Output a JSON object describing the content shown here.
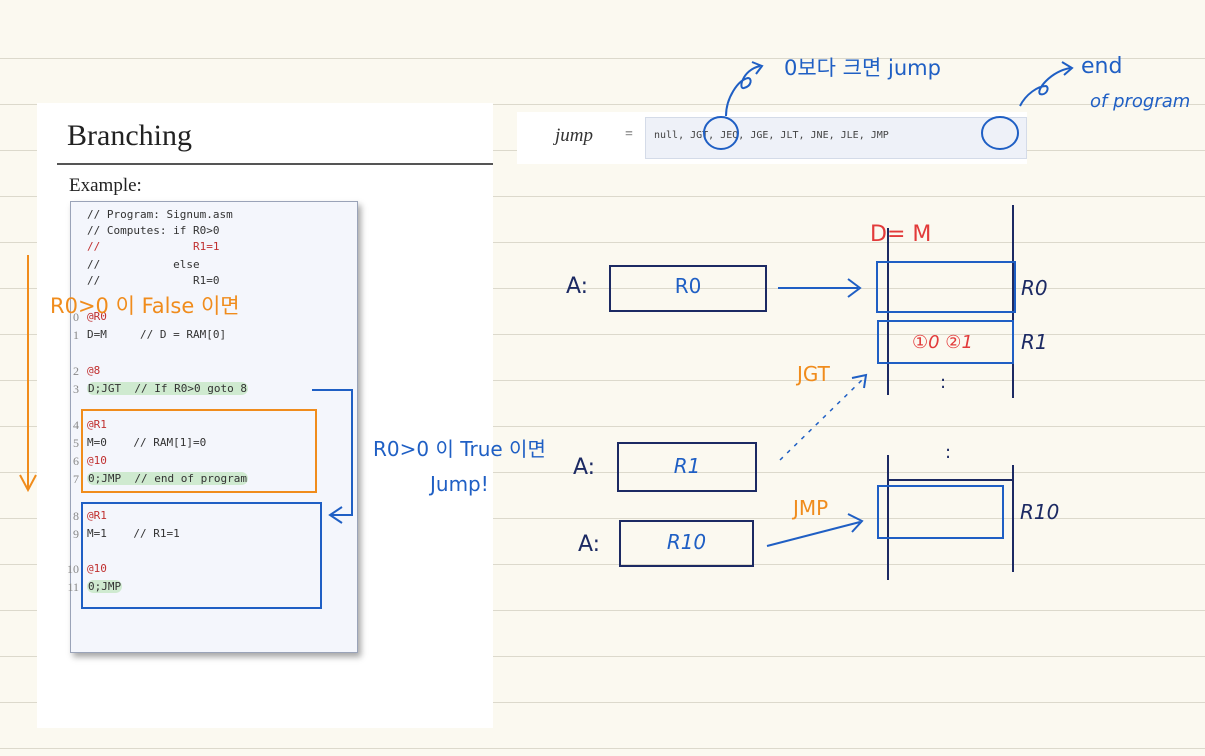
{
  "slide": {
    "title": "Branching",
    "example_label": "Example:",
    "code_lines": [
      {
        "n": "",
        "text": "// Program: Signum.asm"
      },
      {
        "n": "",
        "text": "// Computes: if R0>0"
      },
      {
        "n": "",
        "text": "//              R1=1"
      },
      {
        "n": "",
        "text": "//           else"
      },
      {
        "n": "",
        "text": "//              R1=0"
      },
      {
        "n": "0",
        "text": "@R0"
      },
      {
        "n": "1",
        "text": "D=M     // D = RAM[0]"
      },
      {
        "n": "2",
        "text": "@8"
      },
      {
        "n": "3",
        "text": "D;JGT  // If R0>0 goto 8"
      },
      {
        "n": "4",
        "text": "@R1"
      },
      {
        "n": "5",
        "text": "M=0    // RAM[1]=0"
      },
      {
        "n": "6",
        "text": "@10"
      },
      {
        "n": "7",
        "text": "0;JMP  // end of program"
      },
      {
        "n": "8",
        "text": "@R1"
      },
      {
        "n": "9",
        "text": "M=1    // R1=1"
      },
      {
        "n": "10",
        "text": "@10"
      },
      {
        "n": "11",
        "text": "0;JMP"
      }
    ]
  },
  "jump_syntax": {
    "label": "jump",
    "equals": "=",
    "options_text": "null, JGT, JEQ, JGE, JLT, JNE, JLE, JMP"
  },
  "notes": {
    "jgt_meaning": "0보다 크면 jump",
    "end_of_program_line1": "end",
    "end_of_program_line2": "of program",
    "false_note": "R0>0 이 False 이면",
    "true_note_line1": "R0>0 이 True 이면",
    "true_note_line2": "Jump!",
    "d_eq_m": "D= M"
  },
  "diagram": {
    "a_label": "A:",
    "reg_a_values": [
      "R0",
      "R1",
      "R10"
    ],
    "mem_labels": [
      "R0",
      "R1",
      "R10"
    ],
    "r1_options": "①0 ②1",
    "jgt_label": "JGT",
    "jmp_label": "JMP",
    "dots": [
      ":",
      ":"
    ]
  },
  "colors": {
    "orange": "#f08c1c",
    "blue": "#1f5fc4",
    "navy": "#1c2a63",
    "red": "#e23a3a",
    "paper": "#fbf9f0"
  }
}
